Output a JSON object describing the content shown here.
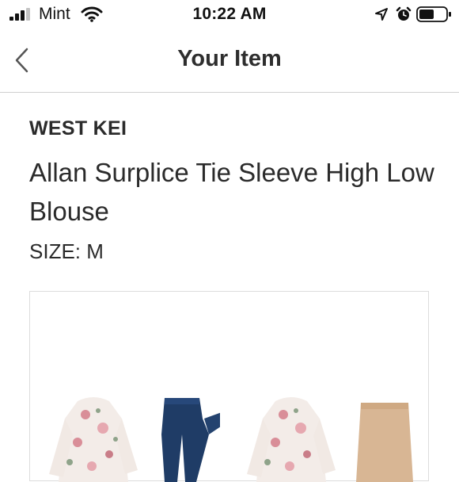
{
  "status_bar": {
    "carrier": "Mint",
    "time": "10:22 AM",
    "icons": [
      "signal-bars-icon",
      "wifi-icon",
      "location-arrow-icon",
      "alarm-clock-icon",
      "battery-icon"
    ]
  },
  "nav": {
    "title": "Your Item",
    "back_icon": "chevron-left-icon"
  },
  "item": {
    "brand": "WEST KEI",
    "name": "Allan Surplice Tie Sleeve High Low Blouse",
    "size_line": "SIZE: M"
  },
  "colors": {
    "text": "#2b2b2b",
    "divider": "#cfcfcf",
    "denim": "#1f3c66",
    "blush_skirt": "#d8b694",
    "blouse_base": "#f3ece8",
    "floral_pink": "#d98e98"
  }
}
